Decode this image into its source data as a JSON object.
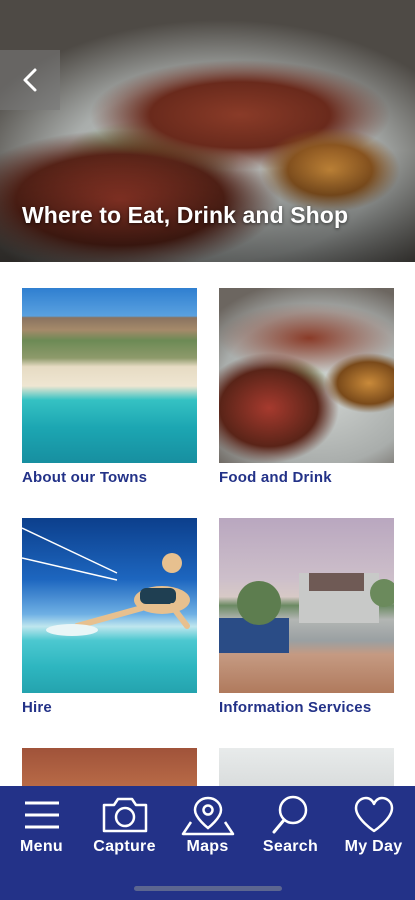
{
  "header": {
    "title": "Where to Eat, Drink and Shop"
  },
  "tiles": [
    {
      "label": "About our Towns"
    },
    {
      "label": "Food and Drink"
    },
    {
      "label": "Hire"
    },
    {
      "label": "Information Services"
    }
  ],
  "nav": {
    "items": [
      {
        "label": "Menu",
        "icon": "menu-icon"
      },
      {
        "label": "Capture",
        "icon": "camera-icon"
      },
      {
        "label": "Maps",
        "icon": "map-pin-icon"
      },
      {
        "label": "Search",
        "icon": "search-icon"
      },
      {
        "label": "My Day",
        "icon": "heart-icon"
      }
    ]
  },
  "colors": {
    "brand": "#233288",
    "background": "#ffffff"
  }
}
